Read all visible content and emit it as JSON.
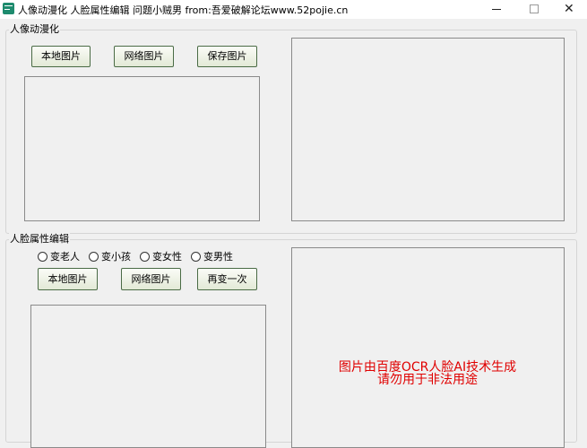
{
  "window": {
    "title": "人像动漫化 人脸属性编辑 问题小贼男 from:吾爱破解论坛www.52pojie.cn",
    "minimize_glyph": "—",
    "maximize_glyph": "□",
    "close_glyph": "✕"
  },
  "anime_section": {
    "legend": "人像动漫化",
    "buttons": {
      "local": "本地图片",
      "network": "网络图片",
      "save": "保存图片"
    }
  },
  "face_section": {
    "legend": "人脸属性编辑",
    "radios": [
      {
        "label": "变老人",
        "checked": false
      },
      {
        "label": "变小孩",
        "checked": false
      },
      {
        "label": "变女性",
        "checked": false
      },
      {
        "label": "变男性",
        "checked": false
      }
    ],
    "buttons": {
      "local": "本地图片",
      "network": "网络图片",
      "redo": "再变一次"
    },
    "notice_line1": "图片由百度OCR人脸AI技术生成",
    "notice_line2": "请勿用于非法用途"
  },
  "colors": {
    "notice": "#e00000",
    "button_border": "#4a6b45",
    "app_icon": "#1e8b6e"
  }
}
